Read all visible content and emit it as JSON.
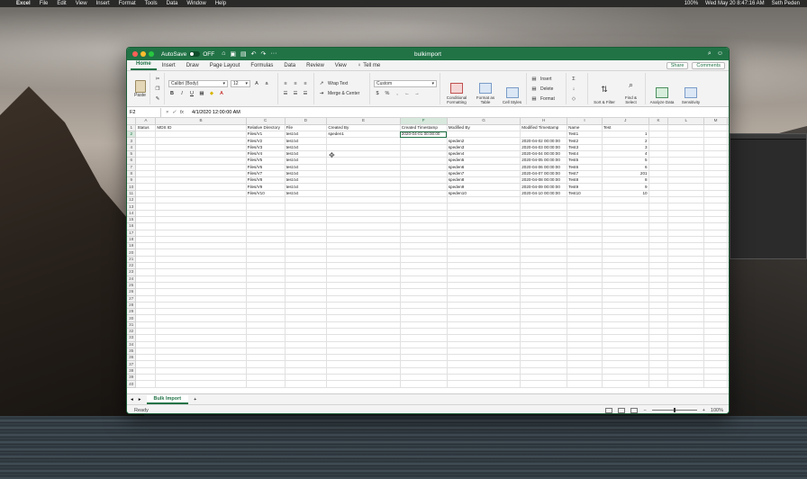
{
  "menubar": {
    "app": "Excel",
    "items": [
      "File",
      "Edit",
      "View",
      "Insert",
      "Format",
      "Tools",
      "Data",
      "Window",
      "Help"
    ],
    "battery": "100%",
    "clock": "Wed May 20  8:47:16 AM",
    "user": "Seth Peden"
  },
  "window": {
    "autosave_label": "AutoSave",
    "autosave_state": "OFF",
    "doc_title": "bulkimport",
    "tabs": [
      "Home",
      "Insert",
      "Draw",
      "Page Layout",
      "Formulas",
      "Data",
      "Review",
      "View"
    ],
    "tell_me": "Tell me",
    "share": "Share",
    "comments": "Comments"
  },
  "ribbon": {
    "paste": "Paste",
    "font_name": "Calibri (Body)",
    "font_size": "12",
    "wrap_text": "Wrap Text",
    "merge_center": "Merge & Center",
    "number_format": "Custom",
    "conditional": "Conditional Formatting",
    "format_table": "Format as Table",
    "cell_styles": "Cell Styles",
    "insert": "Insert",
    "delete": "Delete",
    "format": "Format",
    "sort_filter": "Sort & Filter",
    "find_select": "Find & Select",
    "analyze": "Analyze Data",
    "sensitivity": "Sensitivity"
  },
  "formula_bar": {
    "name_box": "F2",
    "value": "4/1/2020  12:00:00 AM"
  },
  "grid": {
    "columns": [
      "A",
      "B",
      "C",
      "D",
      "E",
      "F",
      "G",
      "H",
      "I",
      "J",
      "K",
      "L",
      "M"
    ],
    "headers": [
      "Status",
      "MDS ID",
      "Relative Directory",
      "File",
      "Created By",
      "Created Timestamp",
      "Modified By",
      "Modified Timestamp",
      "Name",
      "Test",
      "",
      "",
      ""
    ],
    "rows": [
      [
        "",
        "",
        "Files/V1",
        "test.txt",
        "speden1",
        "2020-04-01 00:00:00",
        "",
        "",
        "Test1",
        "1",
        "",
        "",
        ""
      ],
      [
        "",
        "",
        "Files/V2",
        "test.txt",
        "",
        "",
        "speden2",
        "2020-04-02 00:00:00",
        "Test2",
        "2",
        "",
        "",
        ""
      ],
      [
        "",
        "",
        "Files/V3",
        "test.txt",
        "",
        "",
        "speden3",
        "2020-04-03 00:00:00",
        "Test3",
        "3",
        "",
        "",
        ""
      ],
      [
        "",
        "",
        "Files/V4",
        "test.txt",
        "",
        "",
        "speden4",
        "2020-04-04 00:00:00",
        "Test4",
        "4",
        "",
        "",
        ""
      ],
      [
        "",
        "",
        "Files/V5",
        "test.txt",
        "",
        "",
        "speden5",
        "2020-04-05 00:00:00",
        "Test5",
        "5",
        "",
        "",
        ""
      ],
      [
        "",
        "",
        "Files/V6",
        "test.txt",
        "",
        "",
        "speden6",
        "2020-04-06 00:00:00",
        "Test6",
        "6",
        "",
        "",
        ""
      ],
      [
        "",
        "",
        "Files/V7",
        "test.txt",
        "",
        "",
        "speden7",
        "2020-04-07 00:00:00",
        "Test7",
        "201",
        "",
        "",
        ""
      ],
      [
        "",
        "",
        "Files/V8",
        "test.txt",
        "",
        "",
        "speden8",
        "2020-04-08 00:00:00",
        "Test8",
        "8",
        "",
        "",
        ""
      ],
      [
        "",
        "",
        "Files/V9",
        "test.txt",
        "",
        "",
        "speden9",
        "2020-04-09 00:00:00",
        "Test9",
        "9",
        "",
        "",
        ""
      ],
      [
        "",
        "",
        "Files/V10",
        "test.txt",
        "",
        "",
        "speden10",
        "2020-04-10 00:00:00",
        "Test10",
        "10",
        "",
        "",
        ""
      ]
    ],
    "total_rows": 40,
    "selected_column": "F",
    "selected_row": 2
  },
  "sheets": {
    "active": "Bulk Import",
    "add": "+"
  },
  "status": {
    "state": "Ready",
    "zoom": "100%"
  }
}
